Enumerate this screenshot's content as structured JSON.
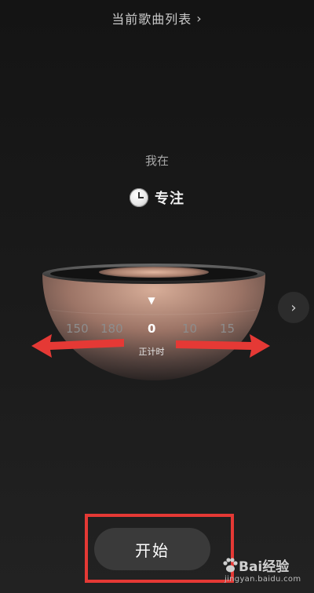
{
  "header": {
    "title": "当前歌曲列表",
    "chevron": "›"
  },
  "mode": {
    "label": "我在",
    "name": "专注",
    "icon": "clock-icon"
  },
  "dial": {
    "pointer": "▼",
    "numbers": [
      "150",
      "180",
      "0",
      "10",
      "15"
    ],
    "active_index": 2,
    "sub_label": "正计时"
  },
  "side_button": {
    "icon": "chevron-right-icon",
    "glyph": "›"
  },
  "start_button": {
    "label": "开始"
  },
  "watermark": {
    "brand": "Bai",
    "brand_suffix": "经验",
    "url": "jingyan.baidu.com"
  },
  "colors": {
    "annotation_red": "#e53935",
    "bowl_copper": "#c99a85",
    "background": "#1b1b1b"
  }
}
